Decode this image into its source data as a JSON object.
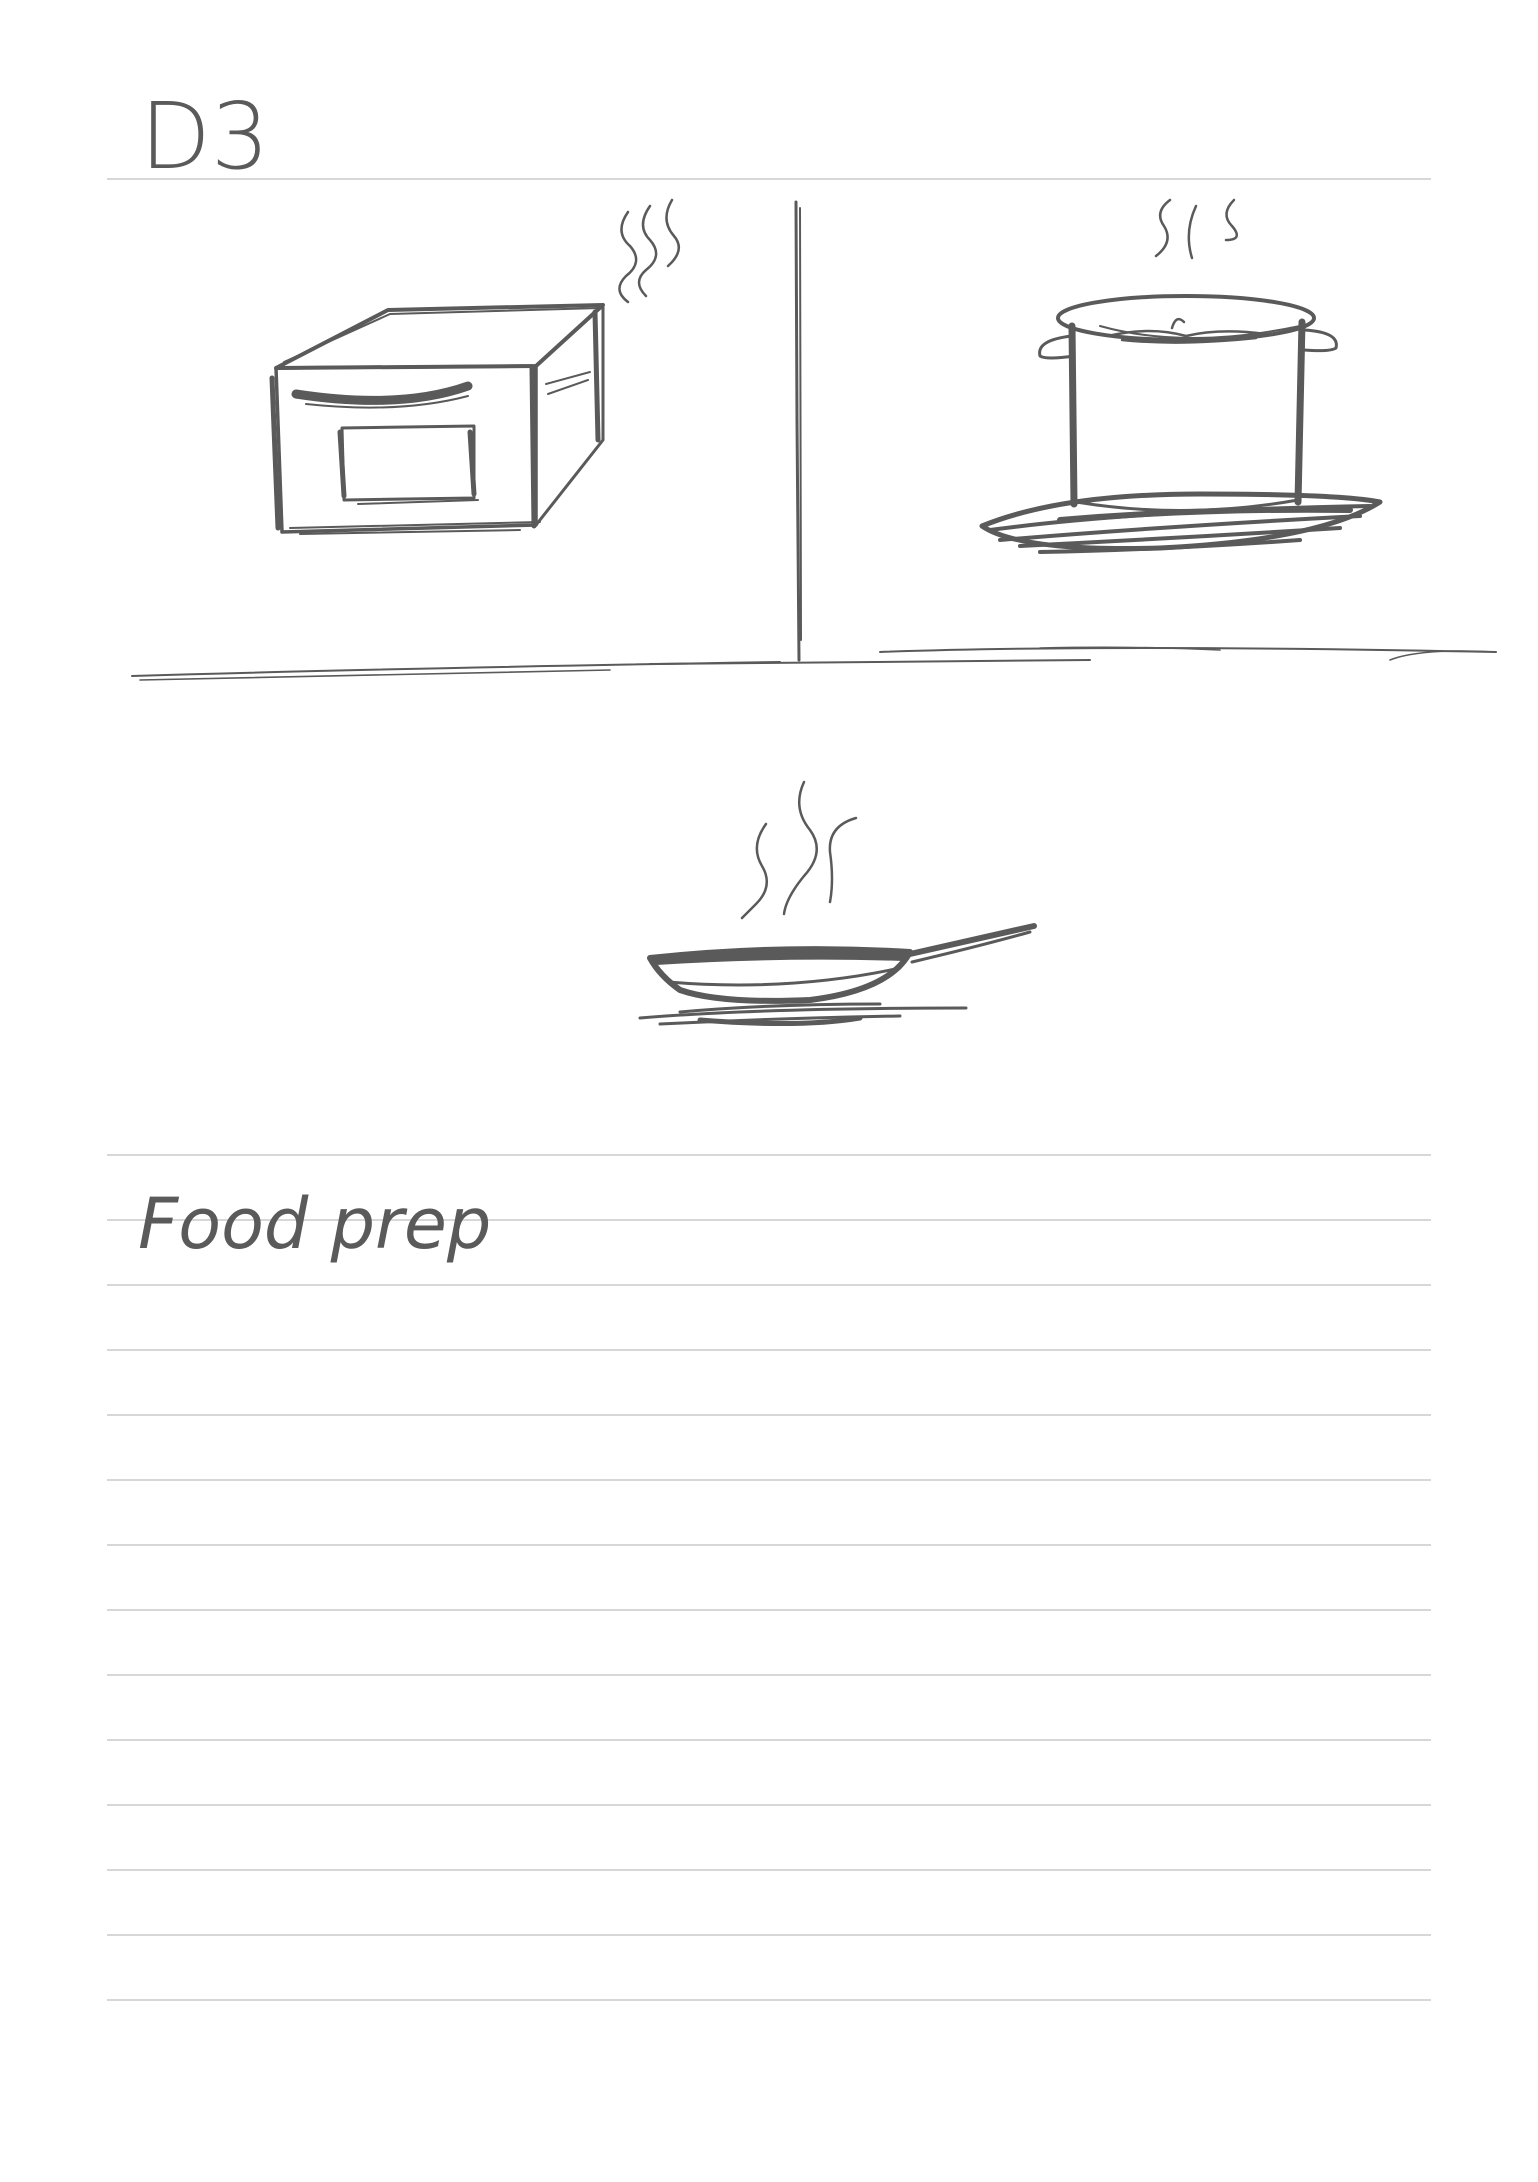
{
  "page": {
    "title": "D3",
    "section_heading": "Food prep"
  },
  "sketches": [
    "oven-with-steam",
    "pot-on-burner",
    "frying-pan-with-steam"
  ],
  "ink_color": "#5a5a5a",
  "rule_color": "#d7d7d7"
}
